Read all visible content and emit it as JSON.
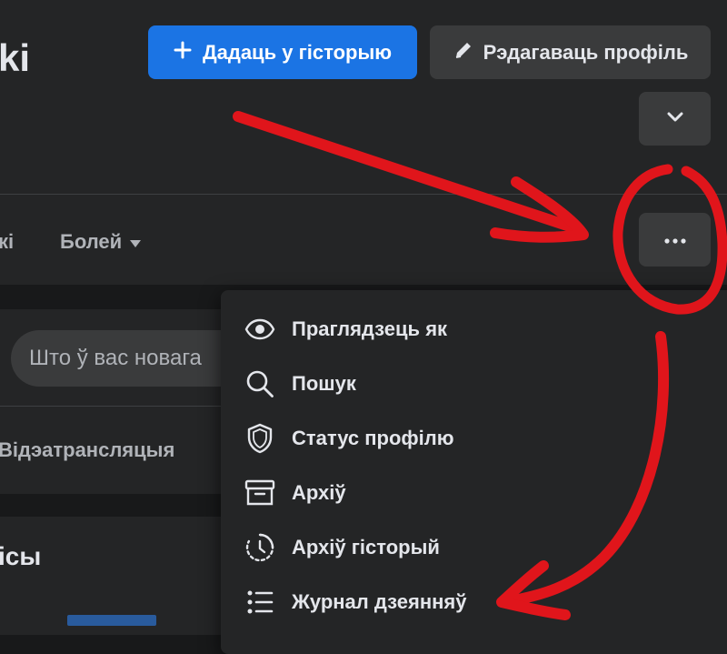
{
  "header": {
    "name_fragment": "ki",
    "add_story_label": "Дадаць у гісторыю",
    "edit_profile_label": "Рэдагаваць профіль"
  },
  "tabs": {
    "fragment": "кі",
    "more_label": "Болей"
  },
  "composer": {
    "placeholder": "Што ў вас новага"
  },
  "actions": {
    "live_video_label": "Відэатрансляцыя"
  },
  "posts": {
    "title_fragment": "ісы"
  },
  "menu": {
    "items": [
      {
        "label": "Праглядзець як",
        "icon": "eye-icon"
      },
      {
        "label": "Пошук",
        "icon": "search-icon"
      },
      {
        "label": "Статус профілю",
        "icon": "shield-icon"
      },
      {
        "label": "Архіў",
        "icon": "archive-icon"
      },
      {
        "label": "Архіў гісторый",
        "icon": "story-archive-icon"
      },
      {
        "label": "Журнал дзеянняў",
        "icon": "activity-log-icon"
      }
    ]
  },
  "colors": {
    "primary": "#1b74e4",
    "annotation": "#e0151b"
  }
}
